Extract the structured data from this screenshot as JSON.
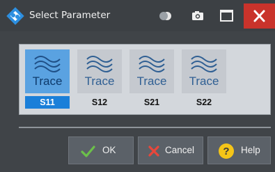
{
  "window": {
    "title": "Select Parameter",
    "accent": "#1a7fd9",
    "close_color": "#c9332b"
  },
  "titlebar_icons": [
    "toggle-icon",
    "camera-icon",
    "maximize-icon",
    "close-icon"
  ],
  "parameters": [
    {
      "icon_text": "Trace",
      "label": "S11",
      "selected": true
    },
    {
      "icon_text": "Trace",
      "label": "S12",
      "selected": false
    },
    {
      "icon_text": "Trace",
      "label": "S21",
      "selected": false
    },
    {
      "icon_text": "Trace",
      "label": "S22",
      "selected": false
    }
  ],
  "buttons": {
    "ok": "OK",
    "cancel": "Cancel",
    "help": "Help"
  }
}
